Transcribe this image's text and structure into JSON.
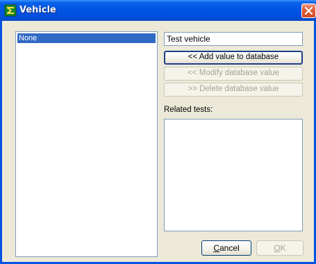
{
  "window": {
    "title": "Vehicle",
    "app_icon": "sigma-app-icon",
    "close_icon": "close-icon",
    "colors": {
      "titlebar": "#0055e5",
      "client_bg": "#ece9d8",
      "selection": "#316ac5",
      "close": "#d14a25"
    }
  },
  "list": {
    "items": [
      {
        "label": "None",
        "selected": true
      }
    ]
  },
  "name_field": {
    "value": "Test vehicle"
  },
  "actions": {
    "add_label": "<< Add value to database",
    "modify_label": "<< Modify database value",
    "delete_label": ">> Delete database value"
  },
  "related": {
    "label": "Related tests:"
  },
  "footer": {
    "cancel_mnemonic": "C",
    "cancel_rest": "ancel",
    "ok_mnemonic": "O",
    "ok_rest": "K"
  }
}
